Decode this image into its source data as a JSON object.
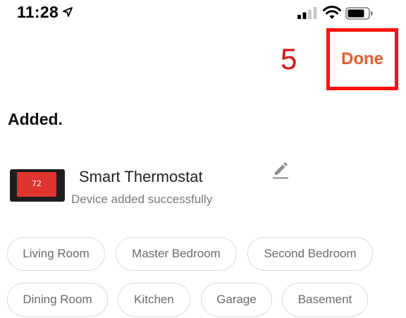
{
  "status_bar": {
    "time": "11:28"
  },
  "annotation": {
    "step_number": "5",
    "highlight_color": "#ff1010"
  },
  "header": {
    "done_label": "Done",
    "accent_color": "#ec5a2d"
  },
  "page": {
    "heading": "Added."
  },
  "device": {
    "name": "Smart Thermostat",
    "status": "Device added successfully",
    "display_temp": "72",
    "edit_icon": "pencil-icon"
  },
  "rooms": [
    "Living Room",
    "Master Bedroom",
    "Second Bedroom",
    "Dining Room",
    "Kitchen",
    "Garage",
    "Basement"
  ]
}
